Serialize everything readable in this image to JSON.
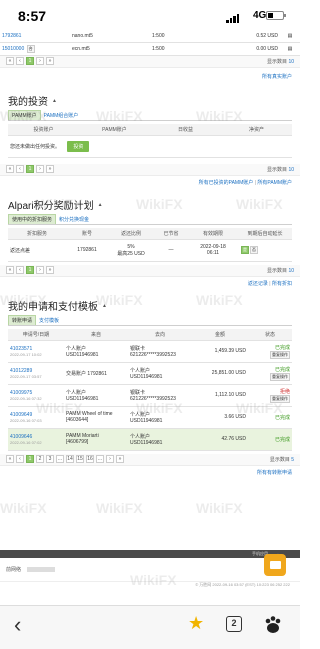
{
  "status_bar": {
    "time": "8:57",
    "network": "4G"
  },
  "accounts_table": {
    "rows": [
      {
        "id": "1792861",
        "server": "nano.mt5",
        "leverage": "1:500",
        "balance": "0.52 USD"
      },
      {
        "id": "15010000",
        "badge": "合",
        "server": "ecn.mt5",
        "leverage": "1:500",
        "balance": "0.00 USD"
      }
    ]
  },
  "pager1": {
    "pages": [
      "«",
      "‹",
      "1",
      "›",
      "»"
    ],
    "show_count_label": "显示数目",
    "show_count": "10"
  },
  "all_real_accounts_link": "所有真实账户",
  "investment": {
    "title": "我的投资",
    "tabs": [
      "PAMM账户",
      "PAMM组合账户"
    ],
    "columns": [
      "投资账户",
      "PAMM账户",
      "日收益",
      "净资产"
    ],
    "empty_text": "您还未做出任何投资。",
    "invest_button": "投资",
    "show_count_label": "显示数目",
    "show_count": "10",
    "links": [
      "所有已投资的PAMM账户",
      "所有PAMM账户"
    ]
  },
  "rewards": {
    "title": "Alpari积分奖励计划",
    "tabs": [
      "使用中的折扣服务",
      "积分兑换现金"
    ],
    "columns": [
      "折扣服务",
      "账号",
      "返还比例",
      "已节省",
      "有效期限",
      "到期后自动延长"
    ],
    "row": {
      "service": "返还点差",
      "account": "1792861",
      "ratio": "5%",
      "ratio_max": "最高25 USD",
      "saved": "—",
      "expiry_date": "2022-09-18",
      "expiry_time": "06:11",
      "renew_yes": "是",
      "renew_no": "否"
    },
    "show_count_label": "显示数目",
    "show_count": "10",
    "links": [
      "返还记录",
      "所有折扣"
    ]
  },
  "applications": {
    "title": "我的申请和支付模板",
    "tabs": [
      "转账申请",
      "支付模板"
    ],
    "columns": [
      "申请号/日期",
      "来自",
      "去向",
      "金额",
      "状态"
    ],
    "rows": [
      {
        "id": "41023571",
        "date": "2022-09-17 10:02",
        "from1": "个人账户",
        "from2": "USD11946981",
        "to1": "银联卡",
        "to2": "621226*****3992523",
        "amount": "1,459.39 USD",
        "status": "已完成",
        "action": "重复操作"
      },
      {
        "id": "41012289",
        "date": "2022-09-17 03:57",
        "from1": "交易账户 1792861",
        "from2": "",
        "to1": "个人账户",
        "to2": "USD11946981",
        "amount": "25,851.00 USD",
        "status": "已完成",
        "action": "重复操作"
      },
      {
        "id": "41009975",
        "date": "2022-09-16 07:32",
        "from1": "个人账户",
        "from2": "USD11946981",
        "to1": "银联卡",
        "to2": "621226*****3992523",
        "amount": "1,112.10 USD",
        "status": "拒绝",
        "action": "重复操作"
      },
      {
        "id": "41009649",
        "date": "2022-09-16 07:03",
        "from1": "PAMM Wheel of time",
        "from2": "[4603644]",
        "to1": "个人账户",
        "to2": "USD11946981",
        "amount": "3.66 USD",
        "status": "已完成",
        "action": ""
      },
      {
        "id": "41009646",
        "date": "2022-09-16 07:02",
        "from1": "PAMM Moriarti",
        "from2": "[4606799]",
        "to1": "个人账户",
        "to2": "USD11946981",
        "amount": "42.76 USD",
        "status": "已完成",
        "action": ""
      }
    ],
    "pager": [
      "«",
      "‹",
      "1",
      "2",
      "3",
      "...",
      "14",
      "15",
      "16",
      "...",
      "›",
      "»"
    ],
    "show_count_label": "显示数目",
    "show_count": "5",
    "all_link": "所有有转账申请"
  },
  "bottom": {
    "mobile_app": "手机应用",
    "account_text": "前网络",
    "footer_text": "© 万胜网 2022-09-16 03:57 (EST) 10:223 06 252 222"
  },
  "watermark": "WikiFX",
  "browser_nav": {
    "tab_count": "2"
  },
  "colors": {
    "accent_green": "#7bbd4c",
    "link_blue": "#1a6fc1",
    "chat_orange": "#f0a71c"
  }
}
